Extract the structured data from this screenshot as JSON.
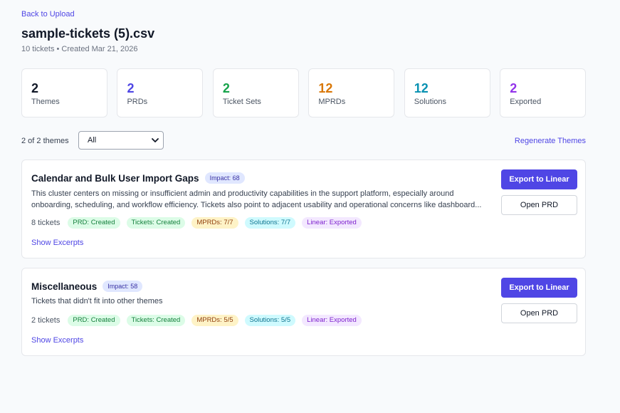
{
  "nav": {
    "back_label": "Back to Upload"
  },
  "file": {
    "title": "sample-tickets (5).csv",
    "meta": "10 tickets • Created Mar 21, 2026"
  },
  "stats": [
    {
      "value": "2",
      "label": "Themes",
      "color": "#111827"
    },
    {
      "value": "2",
      "label": "PRDs",
      "color": "#4f46e5"
    },
    {
      "value": "2",
      "label": "Ticket Sets",
      "color": "#16a34a"
    },
    {
      "value": "12",
      "label": "MPRDs",
      "color": "#d97706"
    },
    {
      "value": "12",
      "label": "Solutions",
      "color": "#0891b2"
    },
    {
      "value": "2",
      "label": "Exported",
      "color": "#9333ea"
    }
  ],
  "filter": {
    "count_text": "2 of 2 themes",
    "selected": "All",
    "regenerate_label": "Regenerate Themes"
  },
  "themes": [
    {
      "title": "Calendar and Bulk User Import Gaps",
      "impact": "Impact: 68",
      "description": "This cluster centers on missing or insufficient admin and productivity capabilities in the support platform, especially around onboarding, scheduling, and workflow efficiency. Tickets also point to adjacent usability and operational concerns like dashboard...",
      "ticket_count": "8 tickets",
      "badges": {
        "prd": "PRD: Created",
        "tickets": "Tickets: Created",
        "mprds": "MPRDs: 7/7",
        "solutions": "Solutions: 7/7",
        "linear": "Linear: Exported"
      },
      "excerpts_label": "Show Excerpts",
      "export_label": "Export to Linear",
      "open_label": "Open PRD"
    },
    {
      "title": "Miscellaneous",
      "impact": "Impact: 58",
      "description": "Tickets that didn't fit into other themes",
      "ticket_count": "2 tickets",
      "badges": {
        "prd": "PRD: Created",
        "tickets": "Tickets: Created",
        "mprds": "MPRDs: 5/5",
        "solutions": "Solutions: 5/5",
        "linear": "Linear: Exported"
      },
      "excerpts_label": "Show Excerpts",
      "export_label": "Export to Linear",
      "open_label": "Open PRD"
    }
  ]
}
